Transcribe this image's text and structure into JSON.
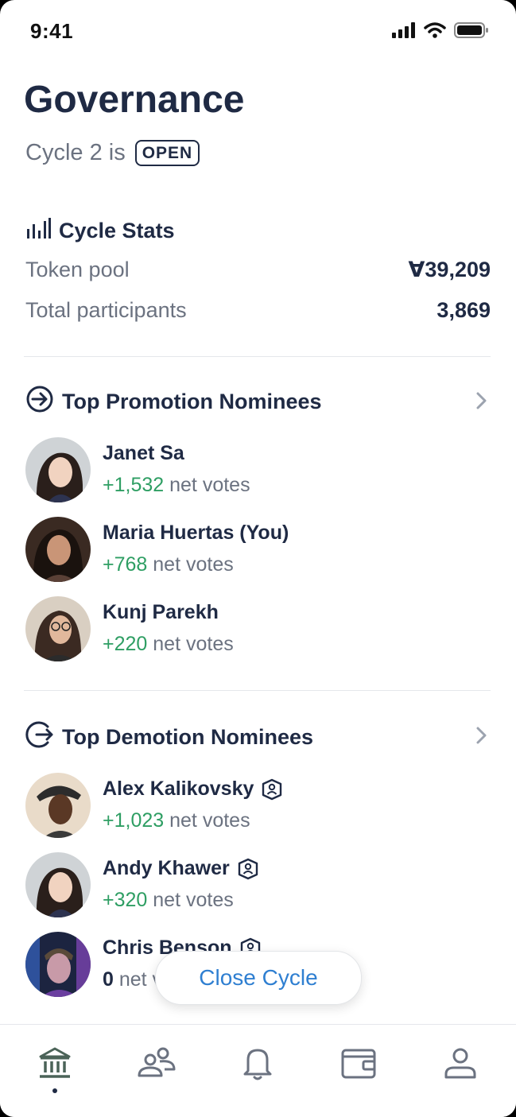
{
  "status_bar": {
    "time": "9:41"
  },
  "header": {
    "title": "Governance",
    "cycle_prefix": "Cycle 2 is",
    "cycle_status": "OPEN"
  },
  "stats": {
    "heading": "Cycle Stats",
    "rows": [
      {
        "label": "Token pool",
        "value": "Ɐ39,209"
      },
      {
        "label": "Total participants",
        "value": "3,869"
      }
    ]
  },
  "promotion": {
    "heading": "Top Promotion Nominees",
    "nominees": [
      {
        "name": "Janet Sa",
        "votes": "+1,532",
        "suffix": "net votes"
      },
      {
        "name": "Maria Huertas (You)",
        "votes": "+768",
        "suffix": "net votes"
      },
      {
        "name": "Kunj Parekh",
        "votes": "+220",
        "suffix": "net votes"
      }
    ]
  },
  "demotion": {
    "heading": "Top Demotion Nominees",
    "nominees": [
      {
        "name": "Alex Kalikovsky",
        "votes": "+1,023",
        "suffix": "net votes"
      },
      {
        "name": "Andy Khawer",
        "votes": "+320",
        "suffix": "net votes"
      },
      {
        "name": "Chris Benson",
        "votes": "0",
        "suffix": "net votes"
      }
    ]
  },
  "actions": {
    "close_cycle": "Close Cycle"
  },
  "tab_bar": {
    "tabs": [
      "governance-icon",
      "people-icon",
      "bell-icon",
      "wallet-icon",
      "profile-icon"
    ],
    "active": "governance-icon"
  },
  "colors": {
    "primary_text": "#1f2a44",
    "secondary_text": "#6b7280",
    "positive": "#2e9e63",
    "link": "#2f7fd1"
  }
}
